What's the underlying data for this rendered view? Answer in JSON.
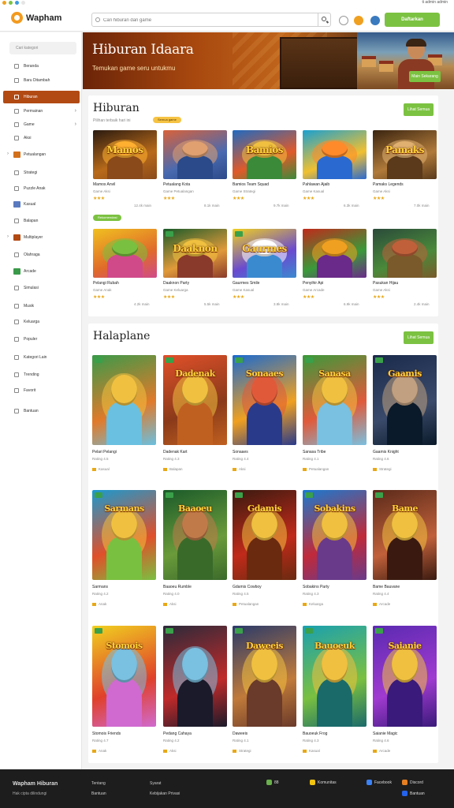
{
  "header": {
    "top_strip_text": "ti admin admin",
    "logo_text": "Wapham",
    "search_placeholder": "Cari hiburan dan game",
    "signin_label": "Daftarkan",
    "colors": {
      "accent": "#7cc242",
      "brand": "#f39a1e",
      "active": "#b24a13"
    }
  },
  "sidebar": {
    "search_label": "Cari kategori",
    "items": [
      {
        "label": "Beranda"
      },
      {
        "label": "Baru Ditambah"
      },
      {
        "label": "Hiburan",
        "active": true
      },
      {
        "label": "Permainan",
        "chevron": true
      },
      {
        "label": "Game",
        "chevron": true
      },
      {
        "label": "Aksi"
      },
      {
        "label": "Petualangan",
        "bullet": true
      },
      {
        "label": "Strategi"
      },
      {
        "label": "Puzzle Anak"
      },
      {
        "label": "Kasual"
      },
      {
        "label": "Balapan"
      },
      {
        "label": "Multiplayer",
        "bullet": true
      },
      {
        "label": "Olahraga"
      },
      {
        "label": "Arcade"
      },
      {
        "label": "Simulasi"
      },
      {
        "label": "Musik"
      },
      {
        "label": "Keluarga"
      },
      {
        "label": "Populer"
      },
      {
        "label": "Kategori Lain"
      },
      {
        "label": "Trending"
      },
      {
        "label": "Favorit"
      },
      {
        "label": "Bantuan"
      }
    ]
  },
  "banner": {
    "title": "Hiburan Idaara",
    "subtitle": "Temukan game seru untukmu",
    "cta": "Main Sekarang"
  },
  "section1": {
    "title": "Hiburan",
    "subtitle": "Pilihan terbaik hari ini",
    "tag": "Semua game",
    "button": "Lihat Semua",
    "row2_tag": "Rekomendasi",
    "cards": [
      {
        "title": "Mamos",
        "name": "Mamos Anvil",
        "meta": "Game Aksi",
        "rating": "★★★",
        "sub": "12.4k main"
      },
      {
        "title": "",
        "name": "Petualang Kota",
        "meta": "Game Petualangan",
        "rating": "★★★",
        "sub": "8.1k main"
      },
      {
        "title": "Bamios",
        "name": "Bamios Team Squad",
        "meta": "Game Strategi",
        "rating": "★★★",
        "sub": "9.7k main"
      },
      {
        "title": "",
        "name": "Pahlawan Ajaib",
        "meta": "Game Kasual",
        "rating": "★★★",
        "sub": "6.3k main"
      },
      {
        "title": "Pamaks",
        "name": "Pamaks Legends",
        "meta": "Game Aksi",
        "rating": "★★★",
        "sub": "7.0k main"
      },
      {
        "title": "",
        "name": "Pelangi Rubah",
        "meta": "Game Anak",
        "rating": "★★★",
        "sub": "4.2k main"
      },
      {
        "title": "Daaknon",
        "name": "Daaknon Party",
        "meta": "Game Keluarga",
        "rating": "★★★",
        "sub": "5.5k main"
      },
      {
        "title": "Gaurmes",
        "name": "Gaurmes Smile",
        "meta": "Game Kasual",
        "rating": "★★★",
        "sub": "3.8k main"
      },
      {
        "title": "",
        "name": "Penyihir Api",
        "meta": "Game Arcade",
        "rating": "★★★",
        "sub": "6.9k main"
      },
      {
        "title": "",
        "name": "Pasukan Hijau",
        "meta": "Game Aksi",
        "rating": "★★★",
        "sub": "2.4k main"
      }
    ]
  },
  "section2": {
    "title": "Halaplane",
    "button": "Lihat Semua",
    "cards": [
      {
        "title": "",
        "name": "Pelari Pelangi",
        "meta": "Rating 4.5",
        "cat": "Kasual"
      },
      {
        "title": "Dadenak",
        "name": "Dadenak Kart",
        "meta": "Rating 4.3",
        "cat": "Balapan"
      },
      {
        "title": "Sonaaes",
        "name": "Sonaaes",
        "meta": "Rating 4.4",
        "cat": "Aksi"
      },
      {
        "title": "Sanasa",
        "name": "Sanasa Tribe",
        "meta": "Rating 4.1",
        "cat": "Petualangan"
      },
      {
        "title": "Gaamis",
        "name": "Gaamis Knight",
        "meta": "Rating 4.6",
        "cat": "Strategi"
      },
      {
        "title": "Sarmans",
        "name": "Sarmans",
        "meta": "Rating 4.2",
        "cat": "Anak"
      },
      {
        "title": "Baaoeu",
        "name": "Baaoeu Rumble",
        "meta": "Rating 4.0",
        "cat": "Aksi"
      },
      {
        "title": "Gdamis",
        "name": "Gdamis Cowboy",
        "meta": "Rating 4.5",
        "cat": "Petualangan"
      },
      {
        "title": "Sobakins",
        "name": "Sobakins Party",
        "meta": "Rating 4.3",
        "cat": "Keluarga"
      },
      {
        "title": "Bame",
        "name": "Bame Bauvane",
        "meta": "Rating 4.4",
        "cat": "Arcade"
      },
      {
        "title": "Stomois",
        "name": "Stomois Friends",
        "meta": "Rating 4.7",
        "cat": "Anak"
      },
      {
        "title": "",
        "name": "Pedang Cahaya",
        "meta": "Rating 4.2",
        "cat": "Aksi"
      },
      {
        "title": "Daweeis",
        "name": "Daweeis",
        "meta": "Rating 4.1",
        "cat": "Strategi"
      },
      {
        "title": "Bauoeuk",
        "name": "Bauoeuk Frog",
        "meta": "Rating 4.3",
        "cat": "Kasual"
      },
      {
        "title": "Saianie",
        "name": "Saianie Magic",
        "meta": "Rating 4.6",
        "cat": "Arcade"
      }
    ]
  },
  "footer": {
    "brand": "Wapham Hiburan",
    "brand_sub": "Hak cipta dilindungi",
    "links": [
      "Tentang",
      "Bantuan",
      "Syarat",
      "Kebijakan Privasi"
    ],
    "social": [
      {
        "label": "88",
        "color": "#6ab04c"
      },
      {
        "label": "Komunitas",
        "color": "#f1c40f"
      },
      {
        "label": "Facebook",
        "color": "#3b82f6"
      },
      {
        "label": "Discord",
        "color": "#e67e22"
      },
      {
        "label": "Bantuan",
        "color": "#2563eb"
      }
    ]
  }
}
